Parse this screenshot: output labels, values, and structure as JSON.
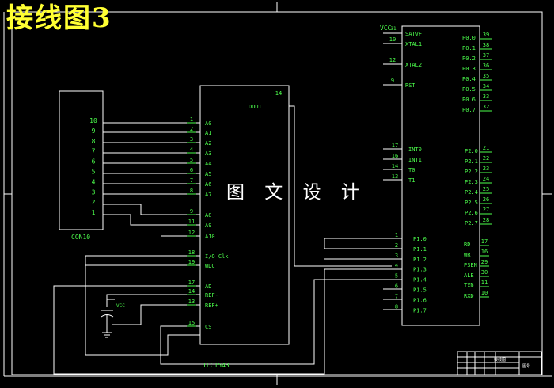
{
  "title": "接线图3",
  "watermark": "图 文 设 计",
  "colors": {
    "background": "#000000",
    "wire": "#ffffff",
    "label": "#4cff4c",
    "title": "#ffff33"
  },
  "connector": {
    "name": "CON10",
    "pins": [
      "10",
      "9",
      "8",
      "7",
      "6",
      "5",
      "4",
      "3",
      "2",
      "1"
    ]
  },
  "adc": {
    "name": "TLC1543",
    "left_pins": [
      {
        "num": "1",
        "label": "A0"
      },
      {
        "num": "2",
        "label": "A1"
      },
      {
        "num": "3",
        "label": "A2"
      },
      {
        "num": "4",
        "label": "A3"
      },
      {
        "num": "5",
        "label": "A4"
      },
      {
        "num": "6",
        "label": "A5"
      },
      {
        "num": "7",
        "label": "A6"
      },
      {
        "num": "8",
        "label": "A7"
      },
      {
        "num": "9",
        "label": "A8"
      },
      {
        "num": "11",
        "label": "A9"
      },
      {
        "num": "12",
        "label": "A10"
      },
      {
        "num": "18",
        "label": "I/O Clk"
      },
      {
        "num": "19",
        "label": "WDC"
      },
      {
        "num": "17",
        "label": "AD"
      },
      {
        "num": "14",
        "label": "REF-"
      },
      {
        "num": "13",
        "label": "REF+"
      },
      {
        "num": "15",
        "label": "CS"
      }
    ],
    "right_pin": {
      "num": "14",
      "label": "DOUT"
    }
  },
  "vcc_cap": "VCC",
  "mcu": {
    "vcc": "VCC",
    "vcc_pin": "31",
    "left_top": [
      {
        "num": "31",
        "label": "SATVF"
      },
      {
        "num": "10",
        "label": "XTAL1"
      },
      {
        "num": "12",
        "label": "XTAL2"
      },
      {
        "num": "9",
        "label": "RST"
      }
    ],
    "left_int": [
      {
        "num": "17",
        "label": "INT0"
      },
      {
        "num": "16",
        "label": "INT1"
      },
      {
        "num": "14",
        "label": "T0"
      },
      {
        "num": "13",
        "label": "T1"
      }
    ],
    "left_p1": [
      {
        "num": "1",
        "label": "P1.0"
      },
      {
        "num": "2",
        "label": "P1.1"
      },
      {
        "num": "3",
        "label": "P1.2"
      },
      {
        "num": "4",
        "label": "P1.3"
      },
      {
        "num": "5",
        "label": "P1.4"
      },
      {
        "num": "6",
        "label": "P1.5"
      },
      {
        "num": "7",
        "label": "P1.6"
      },
      {
        "num": "8",
        "label": "P1.7"
      }
    ],
    "right_p0": [
      {
        "num": "39",
        "label": "P0.0"
      },
      {
        "num": "38",
        "label": "P0.1"
      },
      {
        "num": "37",
        "label": "P0.2"
      },
      {
        "num": "36",
        "label": "P0.3"
      },
      {
        "num": "35",
        "label": "P0.4"
      },
      {
        "num": "34",
        "label": "P0.5"
      },
      {
        "num": "33",
        "label": "P0.6"
      },
      {
        "num": "32",
        "label": "P0.7"
      }
    ],
    "right_p2": [
      {
        "num": "21",
        "label": "P2.0"
      },
      {
        "num": "22",
        "label": "P2.1"
      },
      {
        "num": "23",
        "label": "P2.2"
      },
      {
        "num": "24",
        "label": "P2.3"
      },
      {
        "num": "25",
        "label": "P2.4"
      },
      {
        "num": "26",
        "label": "P2.5"
      },
      {
        "num": "27",
        "label": "P2.6"
      },
      {
        "num": "28",
        "label": "P2.7"
      }
    ],
    "right_ctrl": [
      {
        "num": "17",
        "label": "RD"
      },
      {
        "num": "16",
        "label": "WR"
      },
      {
        "num": "29",
        "label": "PSEN"
      },
      {
        "num": "30",
        "label": "ALE"
      },
      {
        "num": "11",
        "label": "TXD"
      },
      {
        "num": "10",
        "label": "RXD"
      }
    ]
  },
  "title_block": {
    "name_cell": "接线图",
    "sheet_cell": "图号"
  }
}
